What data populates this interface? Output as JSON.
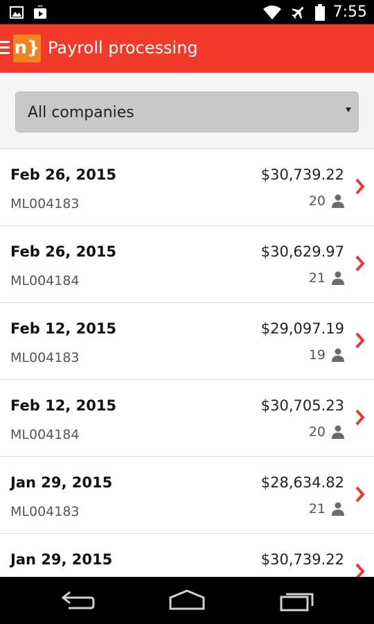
{
  "status_bar": {
    "time": "7:55",
    "icons": [
      "image-icon",
      "play-store-icon",
      "wifi-icon",
      "airplane-icon",
      "battery-icon"
    ]
  },
  "app_bar": {
    "logo_text": "n}",
    "title": "Payroll processing",
    "color": "#f23a2b"
  },
  "filter": {
    "selected": "All companies"
  },
  "payrolls": [
    {
      "date": "Feb 26, 2015",
      "code": "ML004183",
      "amount": "$30,739.22",
      "employees": "20"
    },
    {
      "date": "Feb 26, 2015",
      "code": "ML004184",
      "amount": "$30,629.97",
      "employees": "21"
    },
    {
      "date": "Feb 12, 2015",
      "code": "ML004183",
      "amount": "$29,097.19",
      "employees": "19"
    },
    {
      "date": "Feb 12, 2015",
      "code": "ML004184",
      "amount": "$30,705.23",
      "employees": "20"
    },
    {
      "date": "Jan 29, 2015",
      "code": "ML004183",
      "amount": "$28,634.82",
      "employees": "21"
    },
    {
      "date": "Jan 29, 2015",
      "code": "",
      "amount": "$30,739.22",
      "employees": ""
    }
  ],
  "colors": {
    "accent": "#f23a2b",
    "chevron": "#e53935",
    "logo": "#f58220"
  }
}
